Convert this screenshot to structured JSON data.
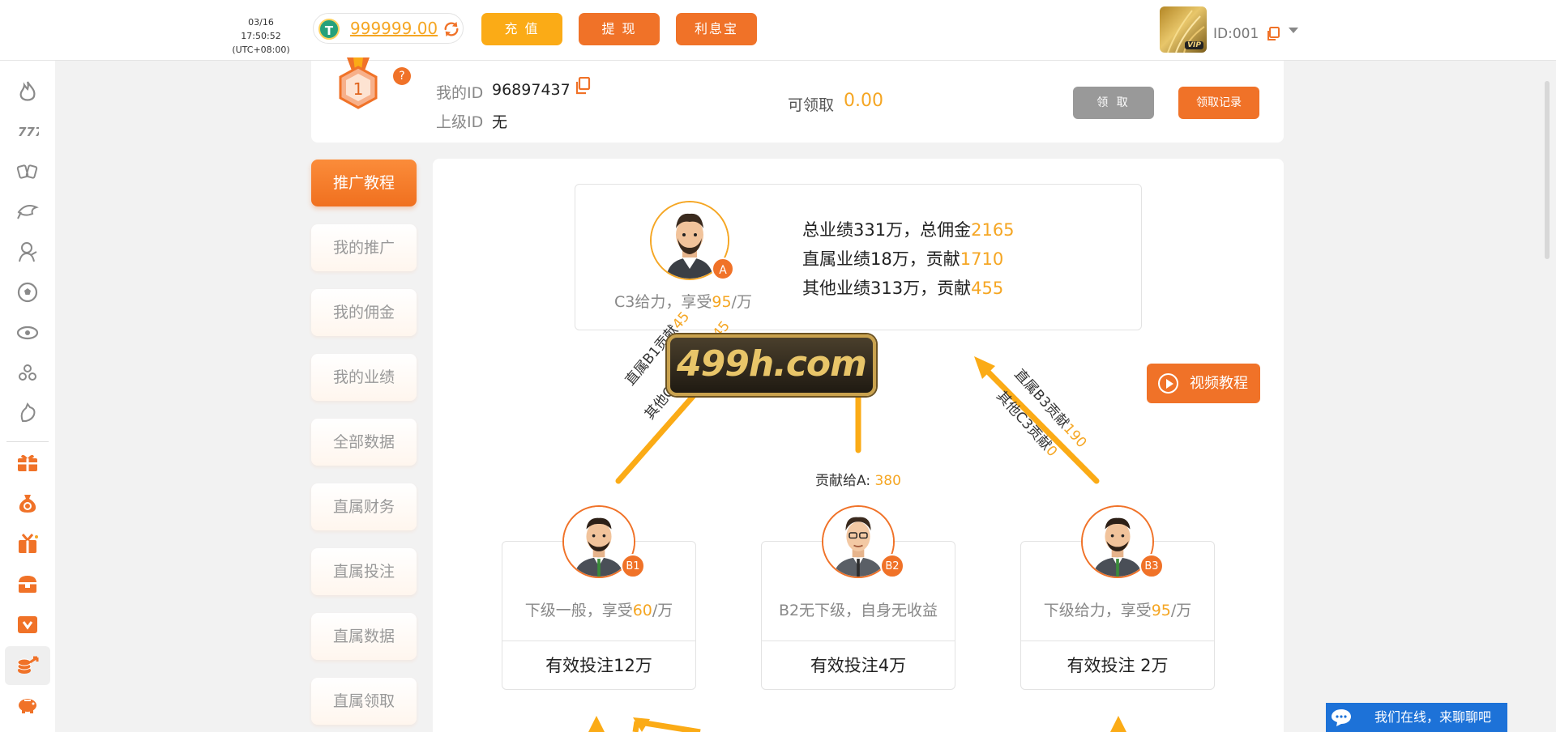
{
  "header": {
    "date": "03/16 17:50:52",
    "timezone": "(UTC+08:00)",
    "currency_icon": "T",
    "balance": "999999.00",
    "recharge_label": "充 值",
    "withdraw_label": "提 现",
    "interest_label": "利息宝",
    "vip_tag": "VIP",
    "user_id": "ID:001"
  },
  "sidebar": {
    "icons": [
      "fire-icon",
      "slots-icon",
      "cards-icon",
      "fishing-icon",
      "live-dealer-icon",
      "soccer-icon",
      "esports-icon",
      "lottery-icon",
      "cockfight-icon",
      "gift-icon",
      "money-bag-icon",
      "giftbox-icon",
      "treasure-icon",
      "vip-shield-icon",
      "promotion-icon",
      "piggy-bank-icon"
    ]
  },
  "info": {
    "rank": "1",
    "help": "?",
    "my_id_label": "我的ID",
    "my_id": "96897437",
    "parent_id_label": "上级ID",
    "parent_id": "无",
    "claimable_label": "可领取",
    "claimable_value": "0.00",
    "claim_button": "领 取",
    "record_button": "领取记录"
  },
  "menu": {
    "items": [
      "推广教程",
      "我的推广",
      "我的佣金",
      "我的业绩",
      "全部数据",
      "直属财务",
      "直属投注",
      "直属数据",
      "直属领取"
    ],
    "active_index": 0
  },
  "diagram": {
    "a": {
      "badge": "A",
      "caption_prefix": "C3给力，享受",
      "caption_rate": "95",
      "caption_suffix": "/万",
      "line1_text": "总业绩331万，总佣金",
      "line1_value": "2165",
      "line2_text": "直属业绩18万，贡献",
      "line2_value": "1710",
      "line3_text": "其他业绩313万，贡献",
      "line3_value": "455"
    },
    "arrow_left": {
      "line1_text": "直属B1贡献",
      "line1_value": "45",
      "line2_text": "其他C1和C2贡献",
      "line2_value": "45"
    },
    "arrow_mid": {
      "text": "贡献给A: ",
      "value": "380"
    },
    "arrow_right": {
      "line1_text": "直属B3贡献",
      "line1_value": "190",
      "line2_text": "其他C3贡献",
      "line2_value": "0"
    },
    "video_button": "视频教程",
    "b1": {
      "badge": "B1",
      "desc_prefix": "下级一般，享受",
      "desc_rate": "60",
      "desc_suffix": "/万",
      "bet": "有效投注12万"
    },
    "b2": {
      "badge": "B2",
      "desc": "B2无下级，自身无收益",
      "bet": "有效投注4万"
    },
    "b3": {
      "badge": "B3",
      "desc_prefix": "下级给力，享受",
      "desc_rate": "95",
      "desc_suffix": "/万",
      "bet": "有效投注 2万"
    }
  },
  "watermark": "499h.com",
  "chat": {
    "label": "我们在线，来聊聊吧"
  },
  "colors": {
    "accent": "#f07228",
    "highlight": "#f5a623",
    "recharge": "#fbab16",
    "chat": "#1d72d8"
  }
}
